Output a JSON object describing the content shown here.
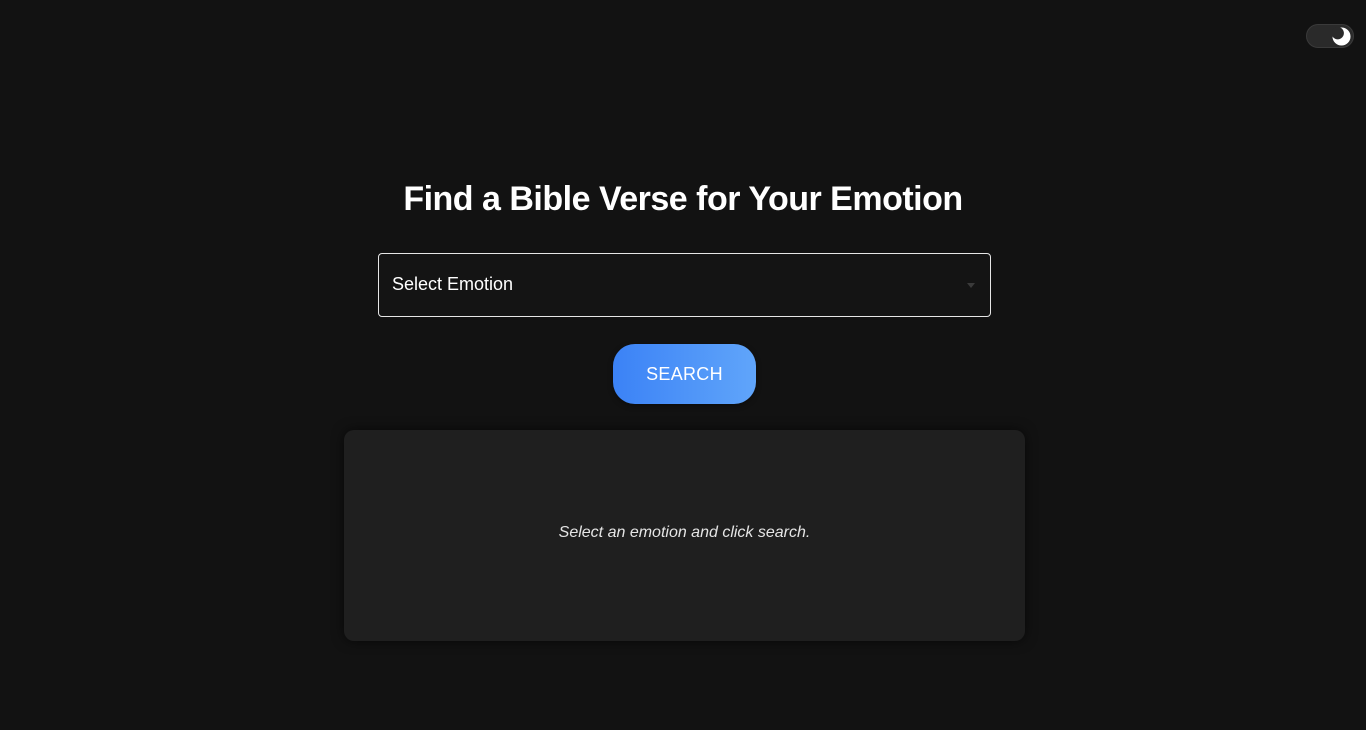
{
  "header": {
    "title": "Find a Bible Verse for Your Emotion"
  },
  "theme_toggle": {
    "icon": "moon-icon",
    "state": "dark"
  },
  "emotion_select": {
    "selected_label": "Select Emotion"
  },
  "search": {
    "button_label": "SEARCH"
  },
  "result": {
    "message": "Select an emotion and click search."
  },
  "colors": {
    "background": "#121212",
    "card": "#1f1f1f",
    "accent_start": "#3b82f6",
    "accent_end": "#60a5fa"
  }
}
